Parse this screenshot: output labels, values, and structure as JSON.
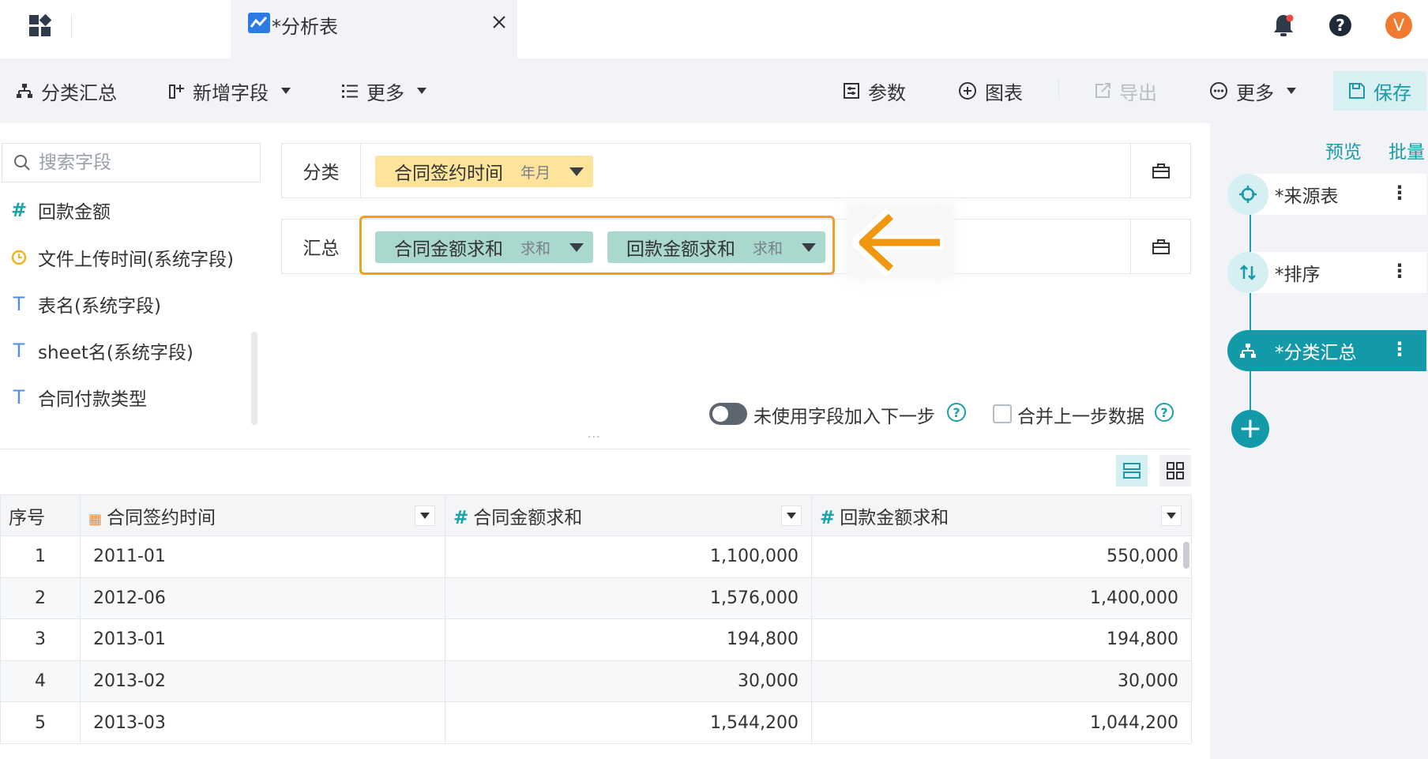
{
  "colors": {
    "accent": "#1a9aa8",
    "yellow_chip": "#fde49a",
    "green_chip": "#a9d8cf",
    "highlight": "#f0a020",
    "avatar": "#f07a2f"
  },
  "topbar": {
    "tab_title": "*分析表",
    "avatar_letter": "V"
  },
  "toolbar": {
    "group_summary": "分类汇总",
    "add_field": "新增字段",
    "more_left": "更多",
    "params": "参数",
    "chart": "图表",
    "export": "导出",
    "more_right": "更多",
    "save": "保存"
  },
  "fields": {
    "search_placeholder": "搜索字段",
    "items": [
      {
        "label": "回款金额",
        "icon": "#"
      },
      {
        "label": "文件上传时间(系统字段)",
        "icon": "clock-icon"
      },
      {
        "label": "表名(系统字段)",
        "icon": "T"
      },
      {
        "label": "sheet名(系统字段)",
        "icon": "T"
      },
      {
        "label": "合同付款类型",
        "icon": "T"
      }
    ]
  },
  "config": {
    "category_label": "分类",
    "category_chip": {
      "name": "合同签约时间",
      "agg": "年月"
    },
    "summary_label": "汇总",
    "summary_chips": [
      {
        "name": "合同金额求和",
        "agg": "求和"
      },
      {
        "name": "回款金额求和",
        "agg": "求和"
      }
    ]
  },
  "options": {
    "unused_fields": "未使用字段加入下一步",
    "merge_prev": "合并上一步数据",
    "splitter_dots": "..."
  },
  "table": {
    "headers": [
      "序号",
      "合同签约时间",
      "合同金额求和",
      "回款金额求和"
    ],
    "rows": [
      [
        "1",
        "2011-01",
        "1,100,000",
        "550,000"
      ],
      [
        "2",
        "2012-06",
        "1,576,000",
        "1,400,000"
      ],
      [
        "3",
        "2013-01",
        "194,800",
        "194,800"
      ],
      [
        "4",
        "2013-02",
        "30,000",
        "30,000"
      ],
      [
        "5",
        "2013-03",
        "1,544,200",
        "1,044,200"
      ]
    ]
  },
  "flow": {
    "preview": "预览",
    "batch": "批量",
    "nodes": [
      "*来源表",
      "*排序",
      "*分类汇总"
    ]
  }
}
